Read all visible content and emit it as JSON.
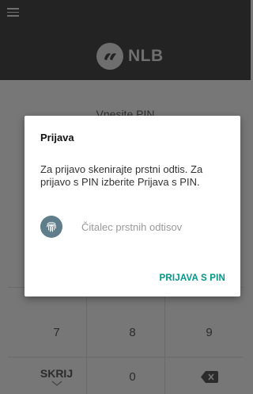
{
  "header": {
    "brand": "NLB"
  },
  "background": {
    "title": "Vnesite PIN"
  },
  "keypad": {
    "keys": [
      "7",
      "8",
      "9"
    ],
    "hide_label": "SKRIJ",
    "zero": "0"
  },
  "dialog": {
    "title": "Prijava",
    "message": "Za prijavo skenirajte prstni odtis. Za prijavo s PIN izberite Prijava s PIN.",
    "fingerprint_label": "Čitalec prstnih odtisov",
    "action_label": "PRIJAVA S PIN"
  },
  "colors": {
    "header_bg": "#232323",
    "scrim_bg": "#777777",
    "accent": "#009688",
    "fingerprint_circle": "#607d8b"
  }
}
